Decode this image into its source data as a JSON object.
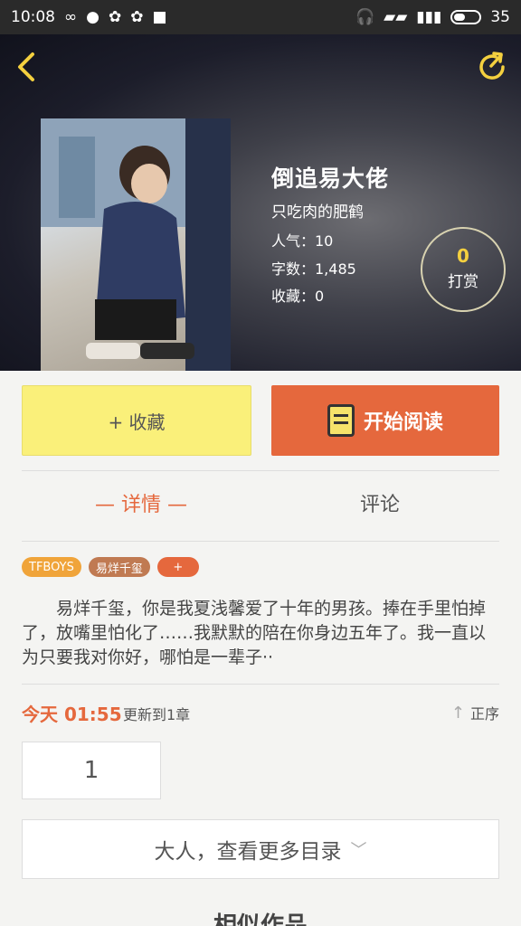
{
  "status_bar": {
    "time": "10:08",
    "battery": "35"
  },
  "header": {
    "back_icon": "back-arrow-icon",
    "share_icon": "share-refresh-icon"
  },
  "book": {
    "title": "倒追易大佬",
    "author": "只吃肉的肥鹤",
    "popularity": "人气：10",
    "word_count": "字数：1,485",
    "favorites": "收藏：0",
    "tip_count": "0",
    "tip_label": "打赏"
  },
  "actions": {
    "favorite_label": "+ 收藏",
    "read_label": "开始阅读"
  },
  "tabs": {
    "detail": "— 详情 —",
    "comment": "评论"
  },
  "tags": [
    "TFBOYS",
    "易烊千玺",
    "+"
  ],
  "synopsis": "易烊千玺，你是我夏浅馨爱了十年的男孩。捧在手里怕掉了，放嘴里怕化了……我默默的陪在你身边五年了。我一直以为只要我对你好，哪怕是一辈子··",
  "updates": {
    "time": "今天 01:55",
    "text": "更新到1章",
    "sort_label": "正序",
    "chapter": "1",
    "more_catalog": "大人，查看更多目录"
  },
  "similar": {
    "heading": "相似作品"
  },
  "colors": {
    "accent": "#e5683d",
    "favorite_bg": "#faf07a",
    "tag_orange": "#f0a43a",
    "tag_brown": "#c07a52"
  }
}
